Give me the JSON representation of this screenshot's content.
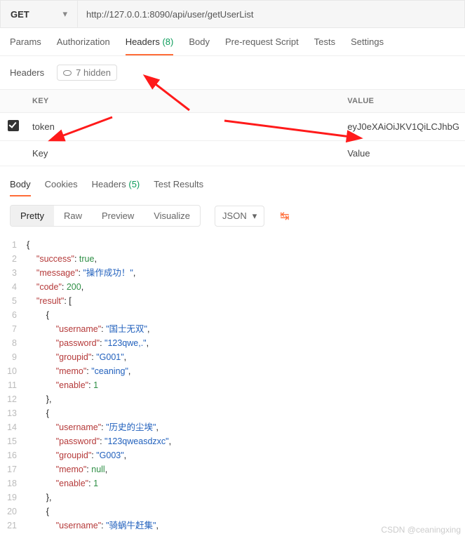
{
  "request": {
    "method": "GET",
    "url": "http://127.0.0.1:8090/api/user/getUserList"
  },
  "tabs": {
    "params": "Params",
    "auth": "Authorization",
    "headers": "Headers",
    "headers_count": "(8)",
    "body": "Body",
    "prereq": "Pre-request Script",
    "tests": "Tests",
    "settings": "Settings"
  },
  "subheader": {
    "title": "Headers",
    "hidden": "7 hidden"
  },
  "table": {
    "key_head": "KEY",
    "val_head": "VALUE",
    "row1": {
      "key": "token",
      "value": "eyJ0eXAiOiJKV1QiLCJhbG"
    },
    "placeholder_key": "Key",
    "placeholder_val": "Value"
  },
  "resp_tabs": {
    "body": "Body",
    "cookies": "Cookies",
    "headers": "Headers",
    "headers_count": "(5)",
    "tests": "Test Results"
  },
  "toolbar": {
    "pretty": "Pretty",
    "raw": "Raw",
    "preview": "Preview",
    "visualize": "Visualize",
    "json": "JSON"
  },
  "code": {
    "lines": [
      [
        [
          "b",
          "{"
        ]
      ],
      [
        [
          "b",
          "    "
        ],
        [
          "k",
          "\"success\""
        ],
        [
          "b",
          ": "
        ],
        [
          "n",
          "true"
        ],
        [
          "b",
          ","
        ]
      ],
      [
        [
          "b",
          "    "
        ],
        [
          "k",
          "\"message\""
        ],
        [
          "b",
          ": "
        ],
        [
          "s",
          "\"操作成功！\""
        ],
        [
          "b",
          ","
        ]
      ],
      [
        [
          "b",
          "    "
        ],
        [
          "k",
          "\"code\""
        ],
        [
          "b",
          ": "
        ],
        [
          "n",
          "200"
        ],
        [
          "b",
          ","
        ]
      ],
      [
        [
          "b",
          "    "
        ],
        [
          "k",
          "\"result\""
        ],
        [
          "b",
          ": ["
        ]
      ],
      [
        [
          "b",
          "        {"
        ]
      ],
      [
        [
          "b",
          "            "
        ],
        [
          "k",
          "\"username\""
        ],
        [
          "b",
          ": "
        ],
        [
          "s",
          "\"国士无双\""
        ],
        [
          "b",
          ","
        ]
      ],
      [
        [
          "b",
          "            "
        ],
        [
          "k",
          "\"password\""
        ],
        [
          "b",
          ": "
        ],
        [
          "s",
          "\"123qwe,.\""
        ],
        [
          "b",
          ","
        ]
      ],
      [
        [
          "b",
          "            "
        ],
        [
          "k",
          "\"groupid\""
        ],
        [
          "b",
          ": "
        ],
        [
          "s",
          "\"G001\""
        ],
        [
          "b",
          ","
        ]
      ],
      [
        [
          "b",
          "            "
        ],
        [
          "k",
          "\"memo\""
        ],
        [
          "b",
          ": "
        ],
        [
          "s",
          "\"ceaning\""
        ],
        [
          "b",
          ","
        ]
      ],
      [
        [
          "b",
          "            "
        ],
        [
          "k",
          "\"enable\""
        ],
        [
          "b",
          ": "
        ],
        [
          "n",
          "1"
        ]
      ],
      [
        [
          "b",
          "        },"
        ]
      ],
      [
        [
          "b",
          "        {"
        ]
      ],
      [
        [
          "b",
          "            "
        ],
        [
          "k",
          "\"username\""
        ],
        [
          "b",
          ": "
        ],
        [
          "s",
          "\"历史的尘埃\""
        ],
        [
          "b",
          ","
        ]
      ],
      [
        [
          "b",
          "            "
        ],
        [
          "k",
          "\"password\""
        ],
        [
          "b",
          ": "
        ],
        [
          "s",
          "\"123qweasdzxc\""
        ],
        [
          "b",
          ","
        ]
      ],
      [
        [
          "b",
          "            "
        ],
        [
          "k",
          "\"groupid\""
        ],
        [
          "b",
          ": "
        ],
        [
          "s",
          "\"G003\""
        ],
        [
          "b",
          ","
        ]
      ],
      [
        [
          "b",
          "            "
        ],
        [
          "k",
          "\"memo\""
        ],
        [
          "b",
          ": "
        ],
        [
          "n",
          "null"
        ],
        [
          "b",
          ","
        ]
      ],
      [
        [
          "b",
          "            "
        ],
        [
          "k",
          "\"enable\""
        ],
        [
          "b",
          ": "
        ],
        [
          "n",
          "1"
        ]
      ],
      [
        [
          "b",
          "        },"
        ]
      ],
      [
        [
          "b",
          "        {"
        ]
      ],
      [
        [
          "b",
          "            "
        ],
        [
          "k",
          "\"username\""
        ],
        [
          "b",
          ": "
        ],
        [
          "s",
          "\"骑蜗牛赶集\""
        ],
        [
          "b",
          ","
        ]
      ]
    ]
  },
  "watermark": "CSDN @ceaningxing"
}
